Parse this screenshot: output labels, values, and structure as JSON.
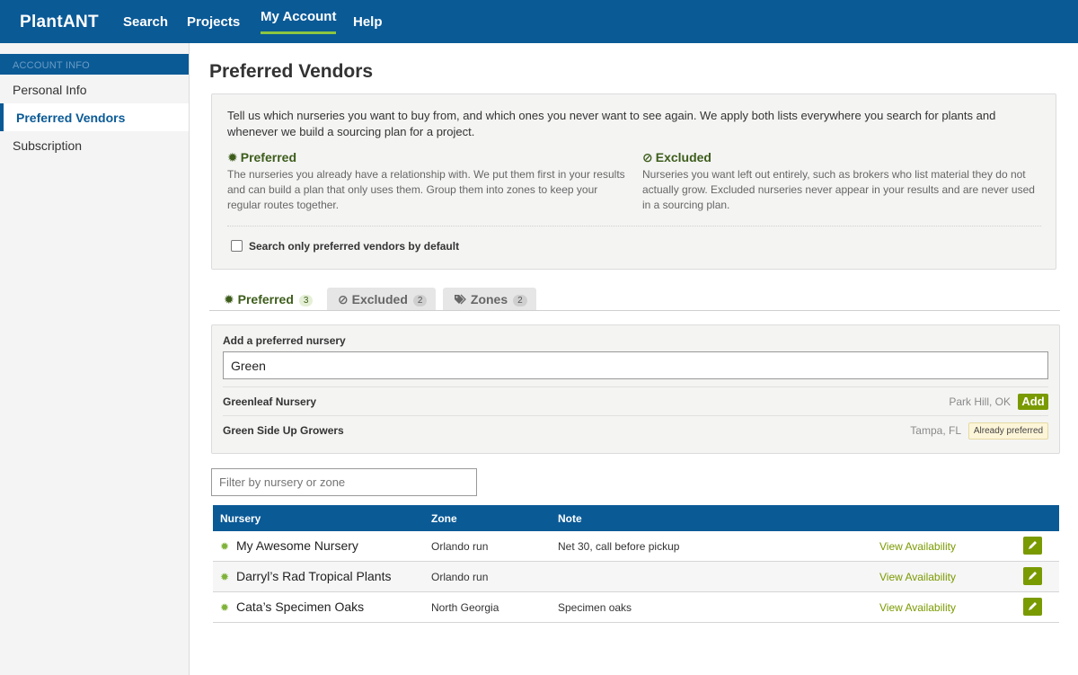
{
  "nav": {
    "brand": "PlantANT",
    "links": [
      "Search",
      "Projects",
      "My Account",
      "Help"
    ],
    "active": "My Account"
  },
  "sidebar": {
    "heading": "ACCOUNT INFO",
    "items": [
      "Personal Info",
      "Preferred Vendors",
      "Subscription"
    ],
    "active": "Preferred Vendors"
  },
  "page": {
    "title": "Preferred Vendors"
  },
  "info": {
    "intro": "Tell us which nurseries you want to buy from, and which ones you never want to see again. We apply both lists everywhere you search for plants and whenever we build a sourcing plan for a project.",
    "preferred_title": "Preferred",
    "preferred_text": "The nurseries you already have a relationship with. We put them first in your results and can build a plan that only uses them. Group them into zones to keep your regular routes together.",
    "excluded_title": "Excluded",
    "excluded_text": "Nurseries you want left out entirely, such as brokers who list material they do not actually grow. Excluded nurseries never appear in your results and are never used in a sourcing plan.",
    "checkbox_label": "Search only preferred vendors by default",
    "checkbox_checked": false
  },
  "tabs": [
    {
      "label": "Preferred",
      "count": "3",
      "active": true
    },
    {
      "label": "Excluded",
      "count": "2",
      "active": false
    },
    {
      "label": "Zones",
      "count": "2",
      "active": false
    }
  ],
  "add": {
    "label": "Add a preferred nursery",
    "value": "Green",
    "results": [
      {
        "name": "Greenleaf Nursery",
        "location": "Park Hill, OK",
        "action": "Add"
      },
      {
        "name": "Green Side Up Growers",
        "location": "Tampa, FL",
        "action": "Already preferred"
      }
    ]
  },
  "filter": {
    "placeholder": "Filter by nursery or zone"
  },
  "table": {
    "headers": [
      "Nursery",
      "Zone",
      "Note"
    ],
    "rows": [
      {
        "name": "My Awesome Nursery",
        "zone": "Orlando run",
        "note": "Net 30, call before pickup",
        "link": "View Availability"
      },
      {
        "name": "Darryl’s Rad Tropical Plants",
        "zone": "Orlando run",
        "note": "",
        "link": "View Availability"
      },
      {
        "name": "Cata’s Specimen Oaks",
        "zone": "North Georgia",
        "note": "Specimen oaks",
        "link": "View Availability"
      }
    ]
  },
  "colors": {
    "brand_blue": "#0a5a96",
    "accent_green": "#7a9a01",
    "preferred_green": "#3d5d1b"
  }
}
